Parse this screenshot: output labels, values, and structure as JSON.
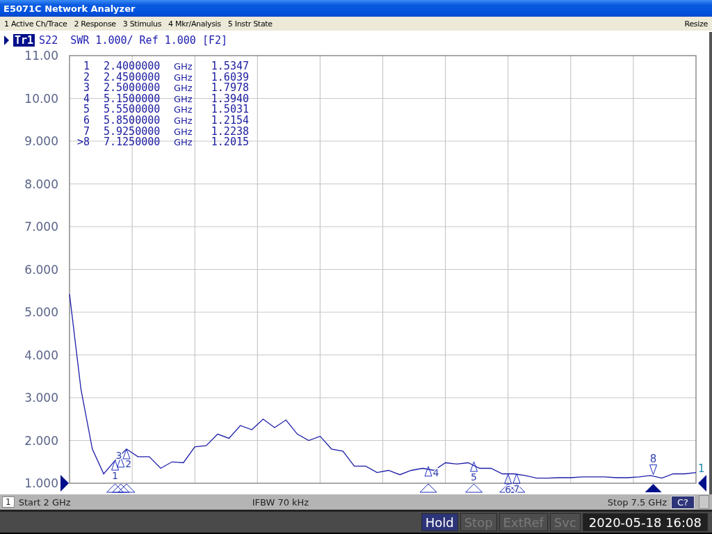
{
  "window": {
    "title": "E5071C Network Analyzer"
  },
  "menu": {
    "items": [
      "1 Active Ch/Trace",
      "2 Response",
      "3 Stimulus",
      "4 Mkr/Analysis",
      "5 Instr State"
    ],
    "resize": "Resize"
  },
  "trace_header": {
    "trace": "Tr1",
    "text": "S22  SWR 1.000/ Ref 1.000 [F2]"
  },
  "marker_table": [
    {
      "label": "1",
      "frequency": "2.4000000",
      "unit": "GHz",
      "value": "1.5347",
      "marker": "1",
      "active": false
    },
    {
      "label": "2",
      "frequency": "2.4500000",
      "unit": "GHz",
      "value": "1.6039",
      "marker": "2",
      "active": false
    },
    {
      "label": "3",
      "frequency": "2.5000000",
      "unit": "GHz",
      "value": "1.7978",
      "marker": "3",
      "active": false
    },
    {
      "label": "4",
      "frequency": "5.1500000",
      "unit": "GHz",
      "value": "1.3940",
      "marker": "4",
      "active": false
    },
    {
      "label": "5",
      "frequency": "5.5500000",
      "unit": "GHz",
      "value": "1.5031",
      "marker": "5",
      "active": false
    },
    {
      "label": "6",
      "frequency": "5.8500000",
      "unit": "GHz",
      "value": "1.2154",
      "marker": "6",
      "active": false
    },
    {
      "label": "7",
      "frequency": "5.9250000",
      "unit": "GHz",
      "value": "1.2238",
      "marker": "7",
      "active": false
    },
    {
      "label": ">8",
      "frequency": "7.1250000",
      "unit": "GHz",
      "value": "1.2015",
      "marker": "8",
      "active": true
    }
  ],
  "trace_end_label": "1",
  "chart_data": {
    "type": "line",
    "categories": [
      null,
      null,
      null,
      null,
      null,
      null,
      null,
      null,
      null,
      null,
      null,
      null,
      null,
      null,
      null,
      null,
      null,
      null,
      null,
      null,
      null,
      null,
      null,
      null,
      null,
      null,
      null,
      null,
      null,
      null,
      null,
      null,
      null,
      null,
      null,
      null,
      null,
      null,
      null,
      null,
      null,
      null,
      null,
      null,
      null,
      null,
      null,
      null,
      null,
      null,
      null,
      null,
      null,
      null,
      null,
      null
    ],
    "series": [
      {
        "color": "#1c1ca8",
        "values": [
          5.42,
          3.2,
          1.8,
          1.22,
          1.53,
          1.8,
          1.62,
          1.62,
          1.35,
          1.5,
          1.48,
          1.85,
          1.88,
          2.15,
          2.05,
          2.35,
          2.25,
          2.5,
          2.3,
          2.48,
          2.15,
          2.0,
          2.1,
          1.8,
          1.75,
          1.4,
          1.4,
          1.25,
          1.3,
          1.2,
          1.3,
          1.35,
          1.3,
          1.48,
          1.45,
          1.48,
          1.35,
          1.35,
          1.22,
          1.22,
          1.18,
          1.12,
          1.12,
          1.13,
          1.13,
          1.15,
          1.15,
          1.15,
          1.13,
          1.13,
          1.15,
          1.18,
          1.12,
          1.22,
          1.22,
          1.25
        ]
      }
    ],
    "ylim": [
      1,
      11
    ],
    "grid": true,
    "yticks": [
      {
        "value": 11,
        "label": "11.00"
      },
      {
        "value": 10,
        "label": "10.00"
      },
      {
        "value": 9,
        "label": "9.000"
      },
      {
        "value": 8,
        "label": "8.000"
      },
      {
        "value": 7,
        "label": "7.000"
      },
      {
        "value": 6,
        "label": "6.000"
      },
      {
        "value": 5,
        "label": "5.000"
      },
      {
        "value": 4,
        "label": "4.000"
      },
      {
        "value": 3,
        "label": "3.000"
      },
      {
        "value": 2,
        "label": "2.000"
      },
      {
        "value": 1,
        "label": "1.000"
      }
    ]
  },
  "status_bar": {
    "channel": "1",
    "start": "Start 2 GHz",
    "ifbw": "IFBW 70 kHz",
    "stop": "Stop 7.5 GHz",
    "cal": "C?"
  },
  "instrument_buttons": [
    {
      "label": "Hold",
      "on": true
    },
    {
      "label": "Stop",
      "on": false
    },
    {
      "label": "ExtRef",
      "on": false
    },
    {
      "label": "Svc",
      "on": false
    }
  ],
  "datetime": "2020-05-18 16:08"
}
